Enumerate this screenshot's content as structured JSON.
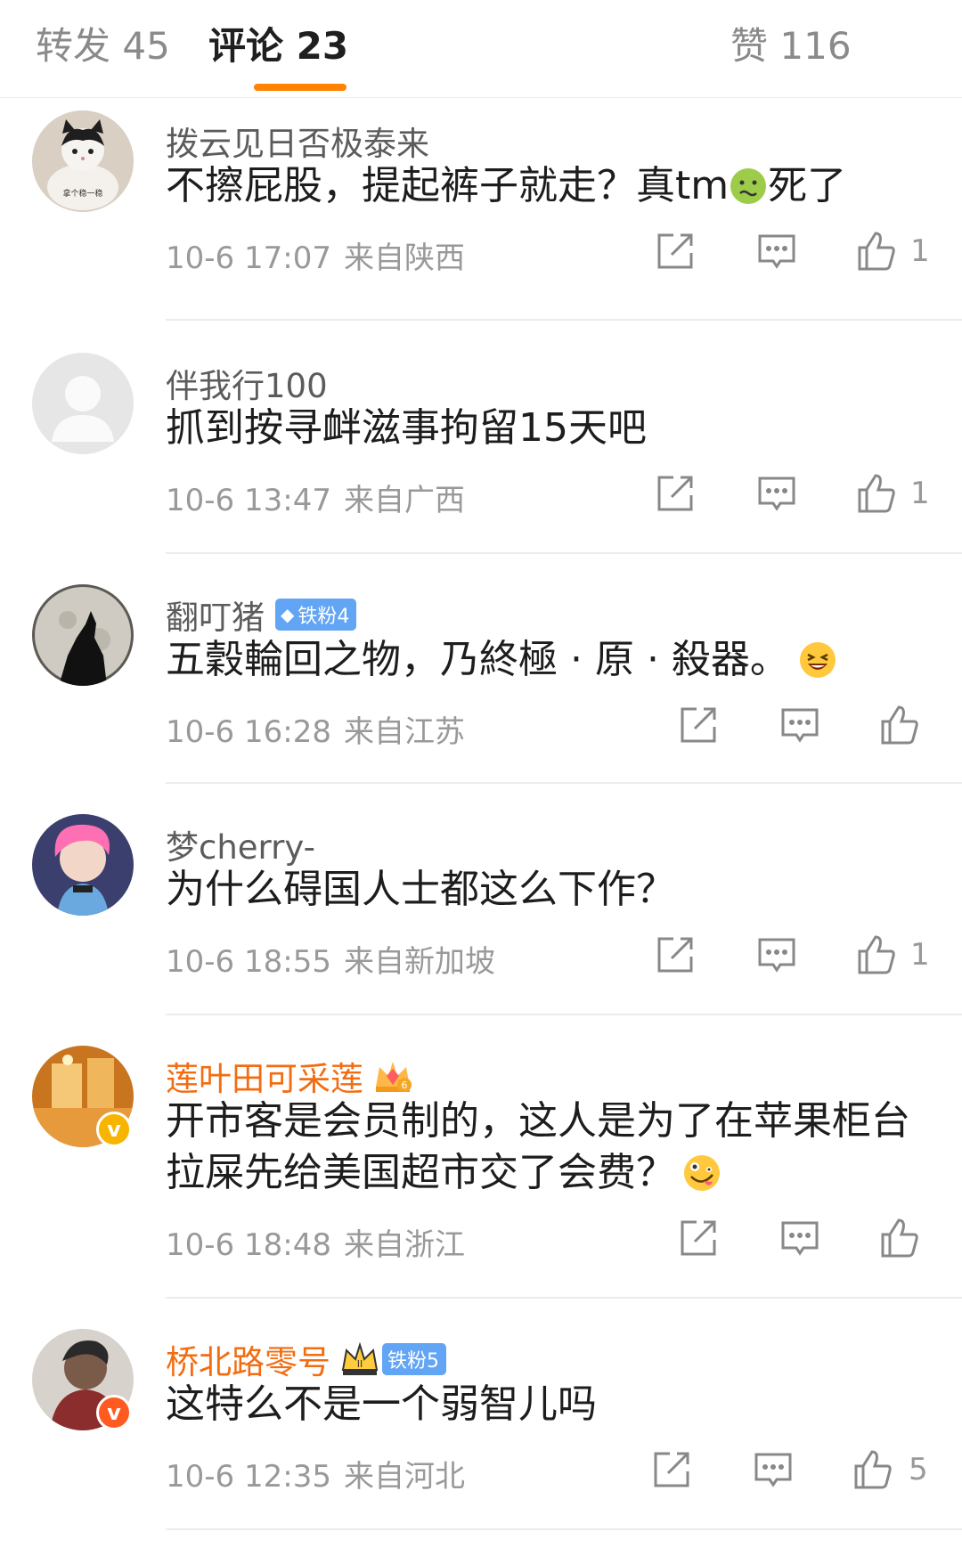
{
  "tabs": [
    {
      "label": "转发",
      "count": "45"
    },
    {
      "label": "评论",
      "count": "23"
    },
    {
      "label": "赞",
      "count": "116"
    }
  ],
  "accent_color": "#ff8200",
  "comments": [
    {
      "username": "拨云见日否极泰来",
      "avatar_text": "拿个稳一稳",
      "text": "不擦屁股，提起裤子就走？真tm",
      "emoji_icon": "nauseated-face-emoji",
      "text_after": "死了",
      "time": "10-6 17:07",
      "location": "来自陕西",
      "likes": "1"
    },
    {
      "username": "伴我行100",
      "text": "抓到按寻衅滋事拘留15天吧",
      "time": "10-6 13:47",
      "location": "来自广西",
      "likes": "1"
    },
    {
      "username": "翻叮猪",
      "fan_badge": "铁粉4",
      "text": "五穀輪回之物，乃終極 · 原 · 殺器。",
      "emoji_icon": "laughing-face-emoji",
      "time": "10-6 16:28",
      "location": "来自江苏",
      "likes": ""
    },
    {
      "username": "梦cherry-",
      "text": "为什么碍国人士都这么下作？",
      "time": "10-6 18:55",
      "location": "来自新加坡",
      "likes": "1"
    },
    {
      "username": "莲叶田可采莲",
      "vip_badge": "6",
      "text": "开市客是会员制的，这人是为了在苹果柜台拉屎先给美国超市交了会费？",
      "emoji_icon": "zany-face-emoji",
      "time": "10-6 18:48",
      "location": "来自浙江",
      "likes": ""
    },
    {
      "username": "桥北路零号",
      "vip_badge": "II",
      "fan_badge": "铁粉5",
      "text": "这特么不是一个弱智儿吗",
      "time": "10-6 12:35",
      "location": "来自河北",
      "likes": "5"
    }
  ]
}
